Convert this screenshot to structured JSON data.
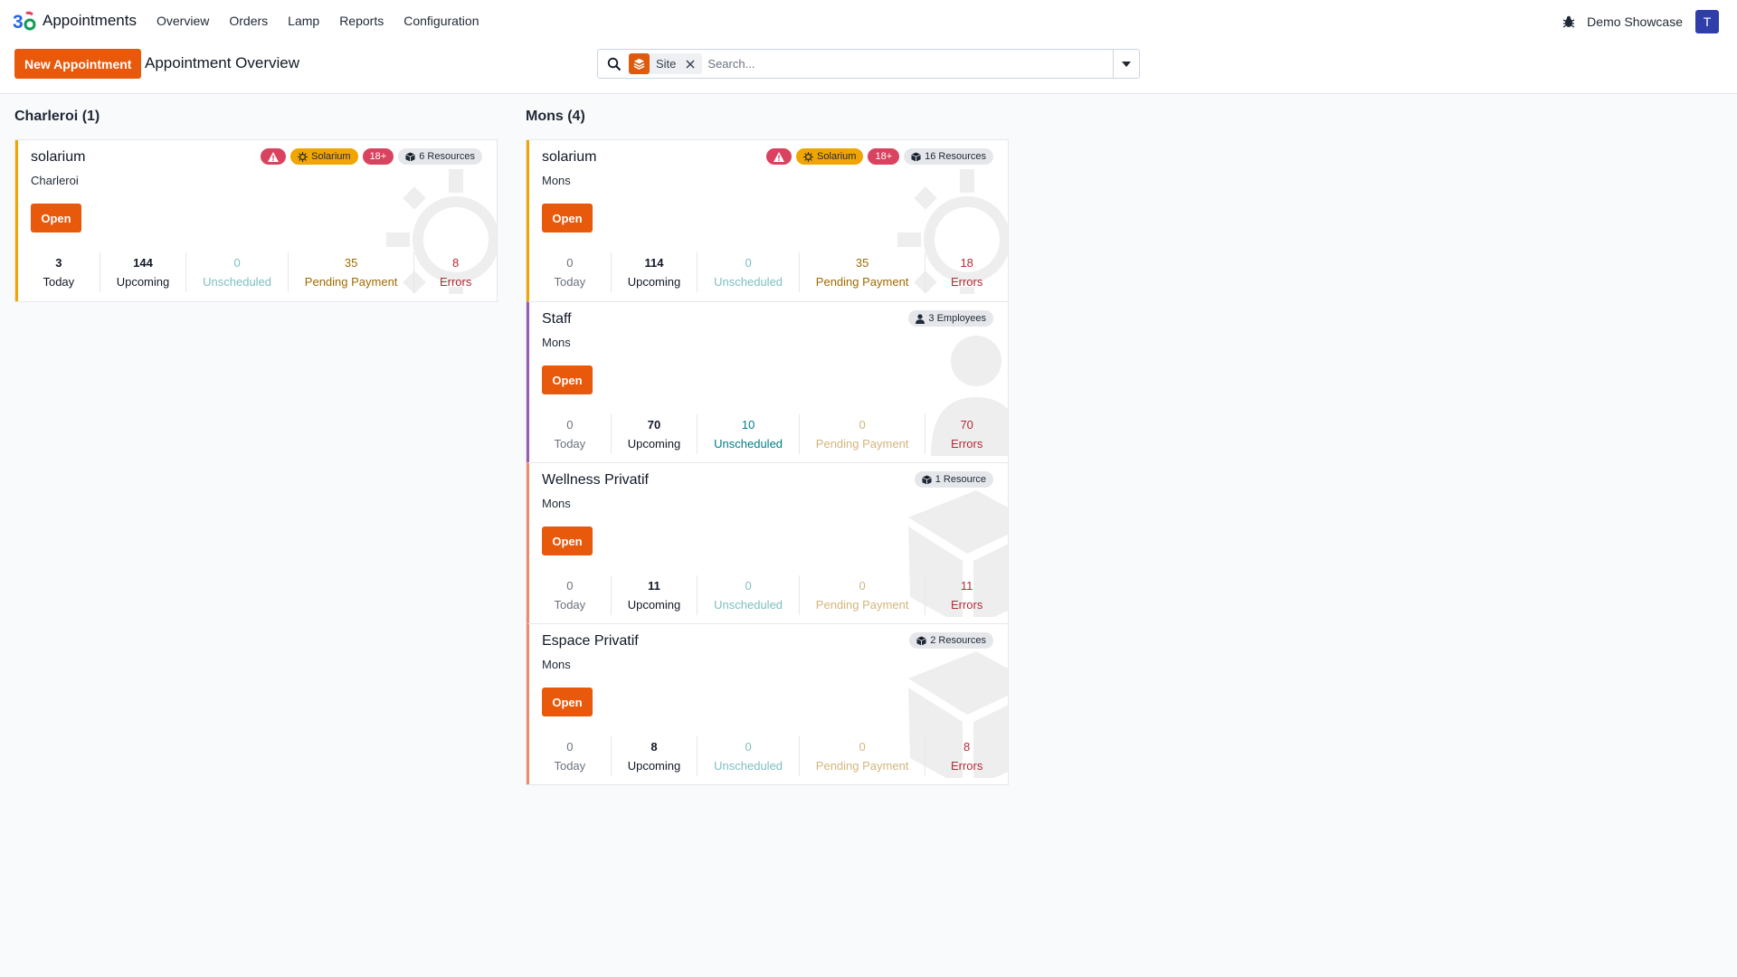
{
  "app": {
    "name": "Appointments"
  },
  "nav": [
    "Overview",
    "Orders",
    "Lamp",
    "Reports",
    "Configuration"
  ],
  "user": {
    "company": "Demo Showcase",
    "initial": "T"
  },
  "toolbar": {
    "new_label": "New Appointment",
    "breadcrumb": "Appointment Overview"
  },
  "search": {
    "facet_label": "Site",
    "placeholder": "Search..."
  },
  "colors": {
    "brand": "#e8590c",
    "solarium_stripe": "#f0a500",
    "staff_stripe": "#9b59b6",
    "space_stripe": "#f08a6c"
  },
  "stat_labels": [
    "Today",
    "Upcoming",
    "Unscheduled",
    "Pending Payment",
    "Errors"
  ],
  "groups": [
    {
      "title": "Charleroi (1)",
      "cards": [
        {
          "title": "solarium",
          "site": "Charleroi",
          "open_label": "Open",
          "badges": [
            "Solarium",
            "18+",
            "6 Resources"
          ],
          "stats": [
            "3",
            "144",
            "0",
            "35",
            "8"
          ]
        }
      ]
    },
    {
      "title": "Mons (4)",
      "cards": [
        {
          "title": "solarium",
          "site": "Mons",
          "open_label": "Open",
          "badges": [
            "Solarium",
            "18+",
            "16 Resources"
          ],
          "stats": [
            "0",
            "114",
            "0",
            "35",
            "18"
          ]
        },
        {
          "title": "Staff",
          "site": "Mons",
          "open_label": "Open",
          "badges": [
            "3 Employees"
          ],
          "stats": [
            "0",
            "70",
            "10",
            "0",
            "70"
          ]
        },
        {
          "title": "Wellness Privatif",
          "site": "Mons",
          "open_label": "Open",
          "badges": [
            "1 Resource"
          ],
          "stats": [
            "0",
            "11",
            "0",
            "0",
            "11"
          ]
        },
        {
          "title": "Espace Privatif",
          "site": "Mons",
          "open_label": "Open",
          "badges": [
            "2 Resources"
          ],
          "stats": [
            "0",
            "8",
            "0",
            "0",
            "8"
          ]
        }
      ]
    }
  ]
}
